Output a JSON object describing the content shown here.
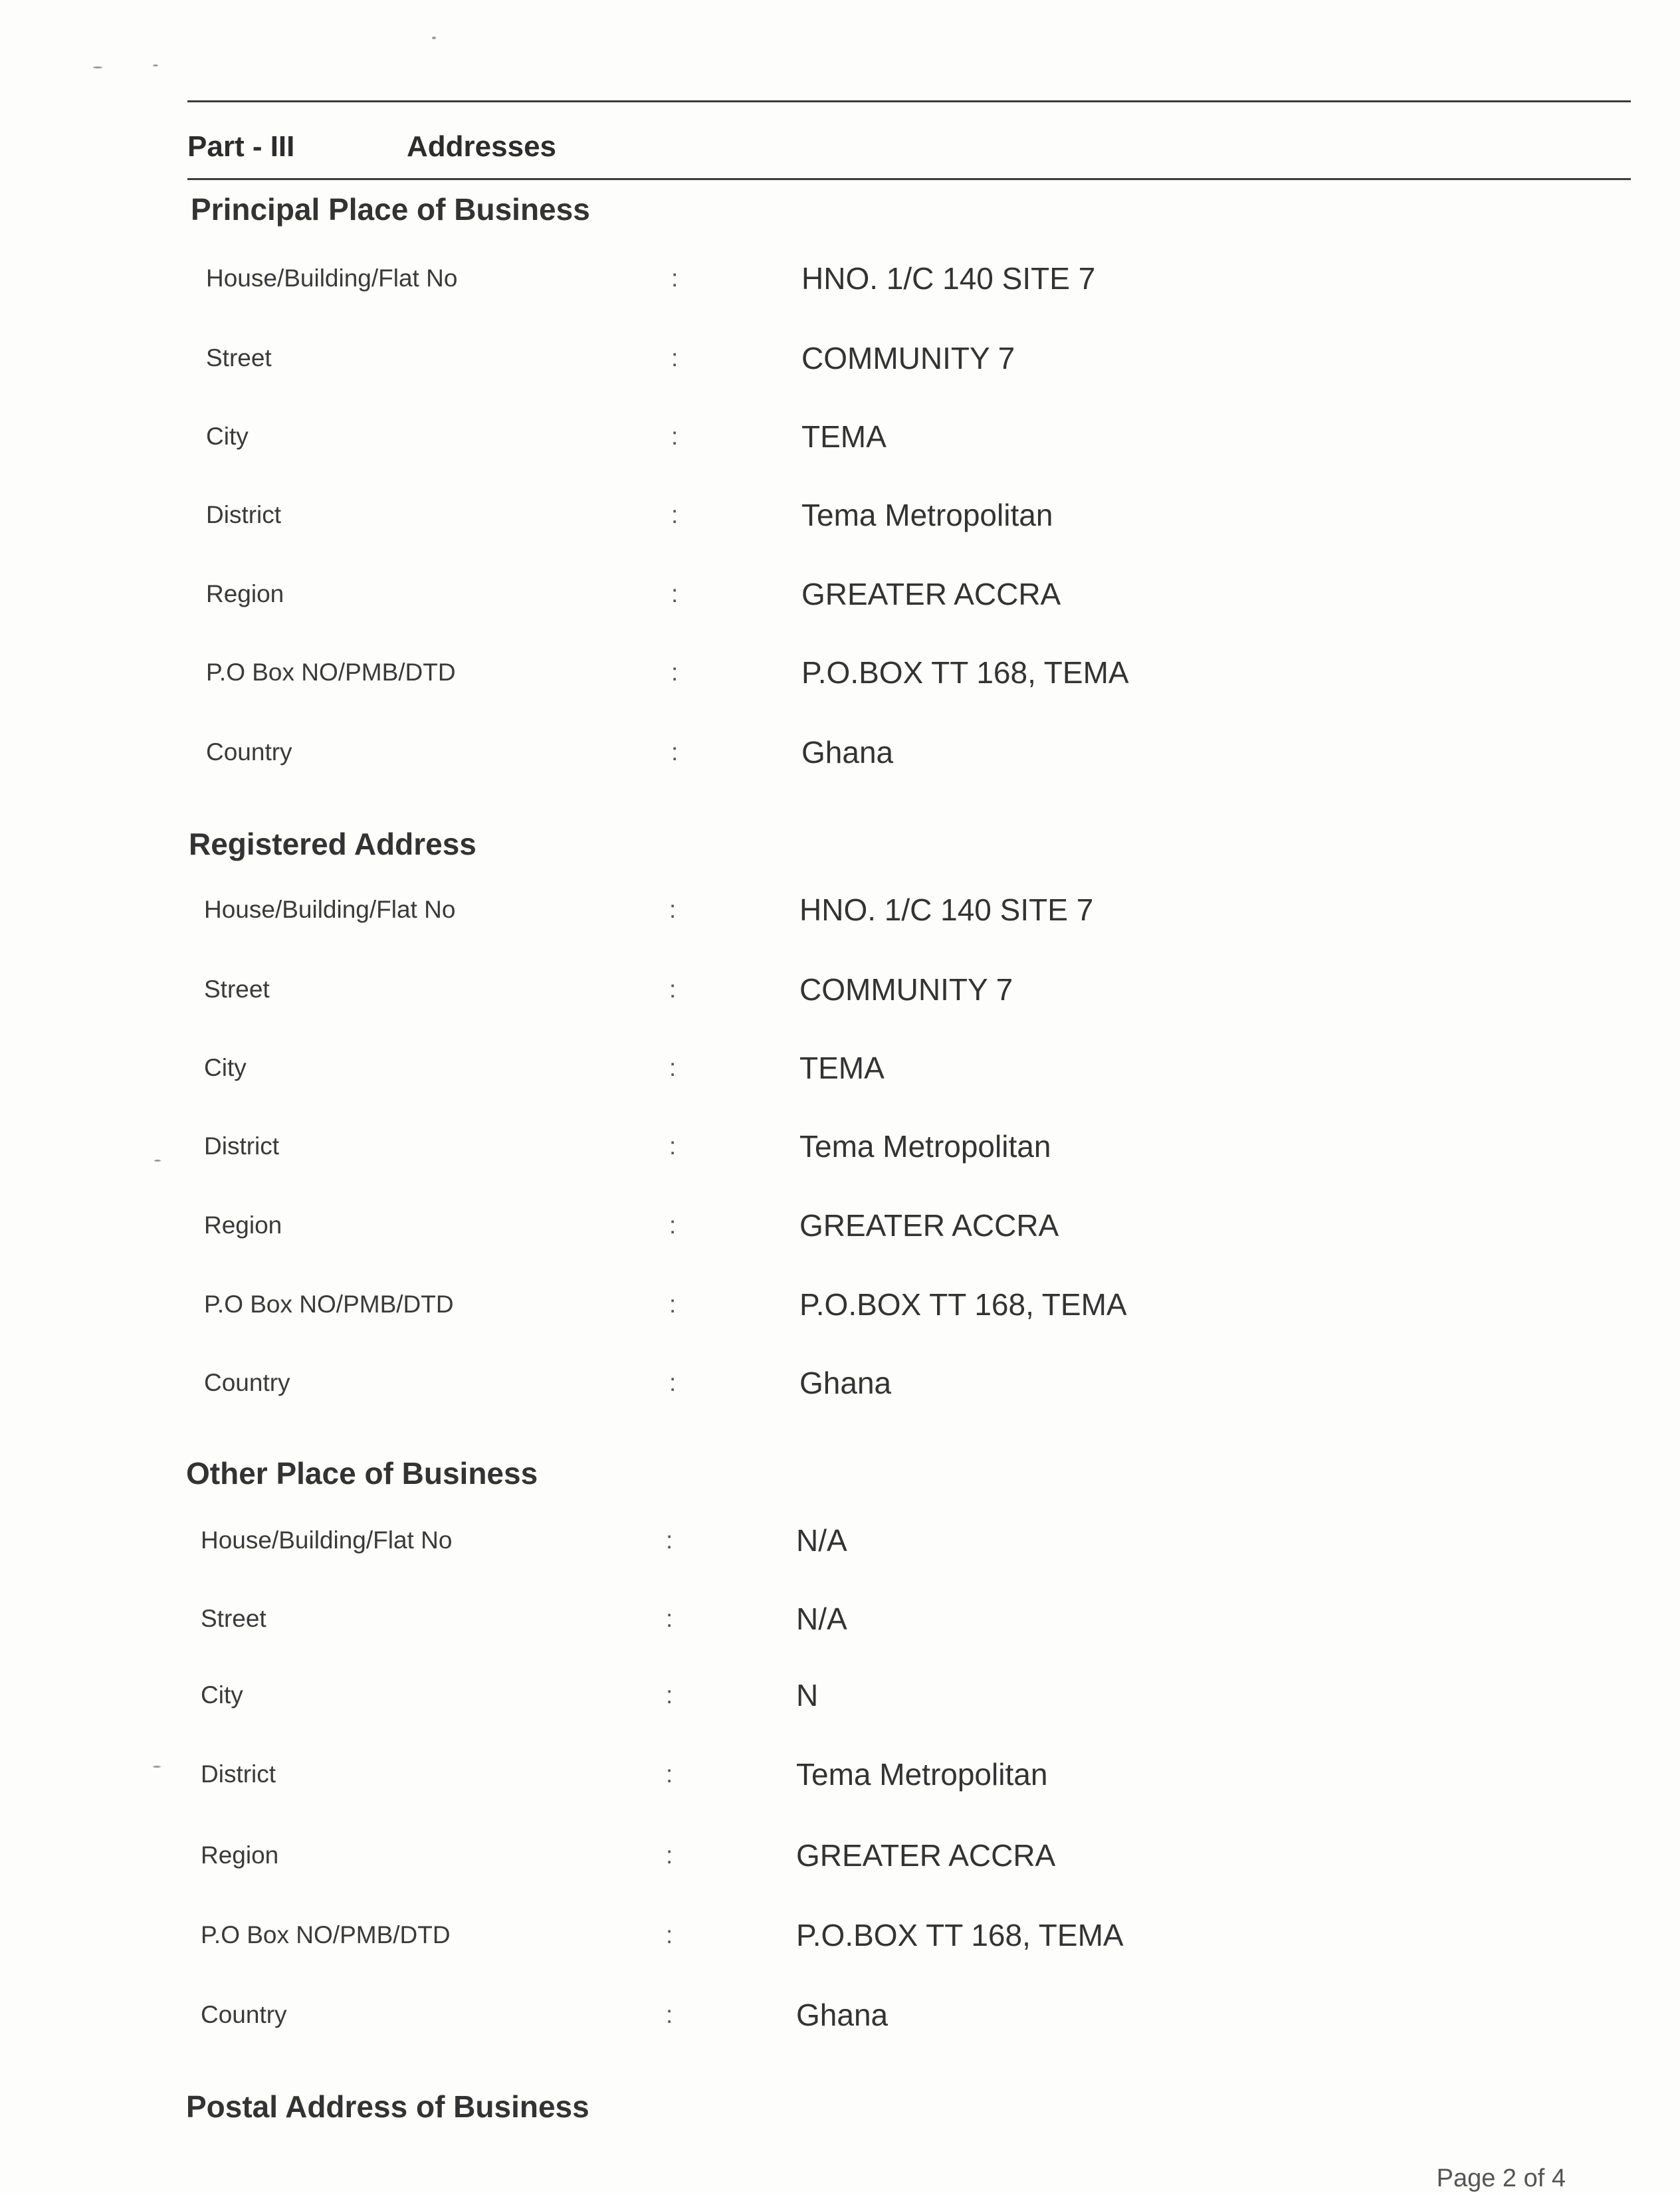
{
  "part": {
    "number": "Part - III",
    "title": "Addresses"
  },
  "sections": [
    {
      "heading": "Principal Place of Business",
      "rows": [
        {
          "label": "House/Building/Flat No",
          "value": "HNO. 1/C 140 SITE 7"
        },
        {
          "label": "Street",
          "value": "COMMUNITY 7"
        },
        {
          "label": "City",
          "value": "TEMA"
        },
        {
          "label": "District",
          "value": "Tema Metropolitan"
        },
        {
          "label": "Region",
          "value": "GREATER ACCRA"
        },
        {
          "label": "P.O Box NO/PMB/DTD",
          "value": "P.O.BOX TT 168, TEMA"
        },
        {
          "label": "Country",
          "value": "Ghana"
        }
      ]
    },
    {
      "heading": "Registered Address",
      "rows": [
        {
          "label": "House/Building/Flat No",
          "value": "HNO. 1/C 140 SITE 7"
        },
        {
          "label": "Street",
          "value": "COMMUNITY 7"
        },
        {
          "label": "City",
          "value": "TEMA"
        },
        {
          "label": "District",
          "value": "Tema Metropolitan"
        },
        {
          "label": "Region",
          "value": "GREATER ACCRA"
        },
        {
          "label": "P.O Box NO/PMB/DTD",
          "value": "P.O.BOX TT 168, TEMA"
        },
        {
          "label": "Country",
          "value": "Ghana"
        }
      ]
    },
    {
      "heading": "Other Place of Business",
      "rows": [
        {
          "label": "House/Building/Flat No",
          "value": "N/A"
        },
        {
          "label": "Street",
          "value": "N/A"
        },
        {
          "label": "City",
          "value": "N"
        },
        {
          "label": "District",
          "value": "Tema Metropolitan"
        },
        {
          "label": "Region",
          "value": "GREATER ACCRA"
        },
        {
          "label": "P.O Box NO/PMB/DTD",
          "value": "P.O.BOX TT 168, TEMA"
        },
        {
          "label": "Country",
          "value": "Ghana"
        }
      ]
    },
    {
      "heading": "Postal Address of Business",
      "rows": []
    }
  ],
  "colon": ":",
  "page_number": "Page 2 of 4"
}
